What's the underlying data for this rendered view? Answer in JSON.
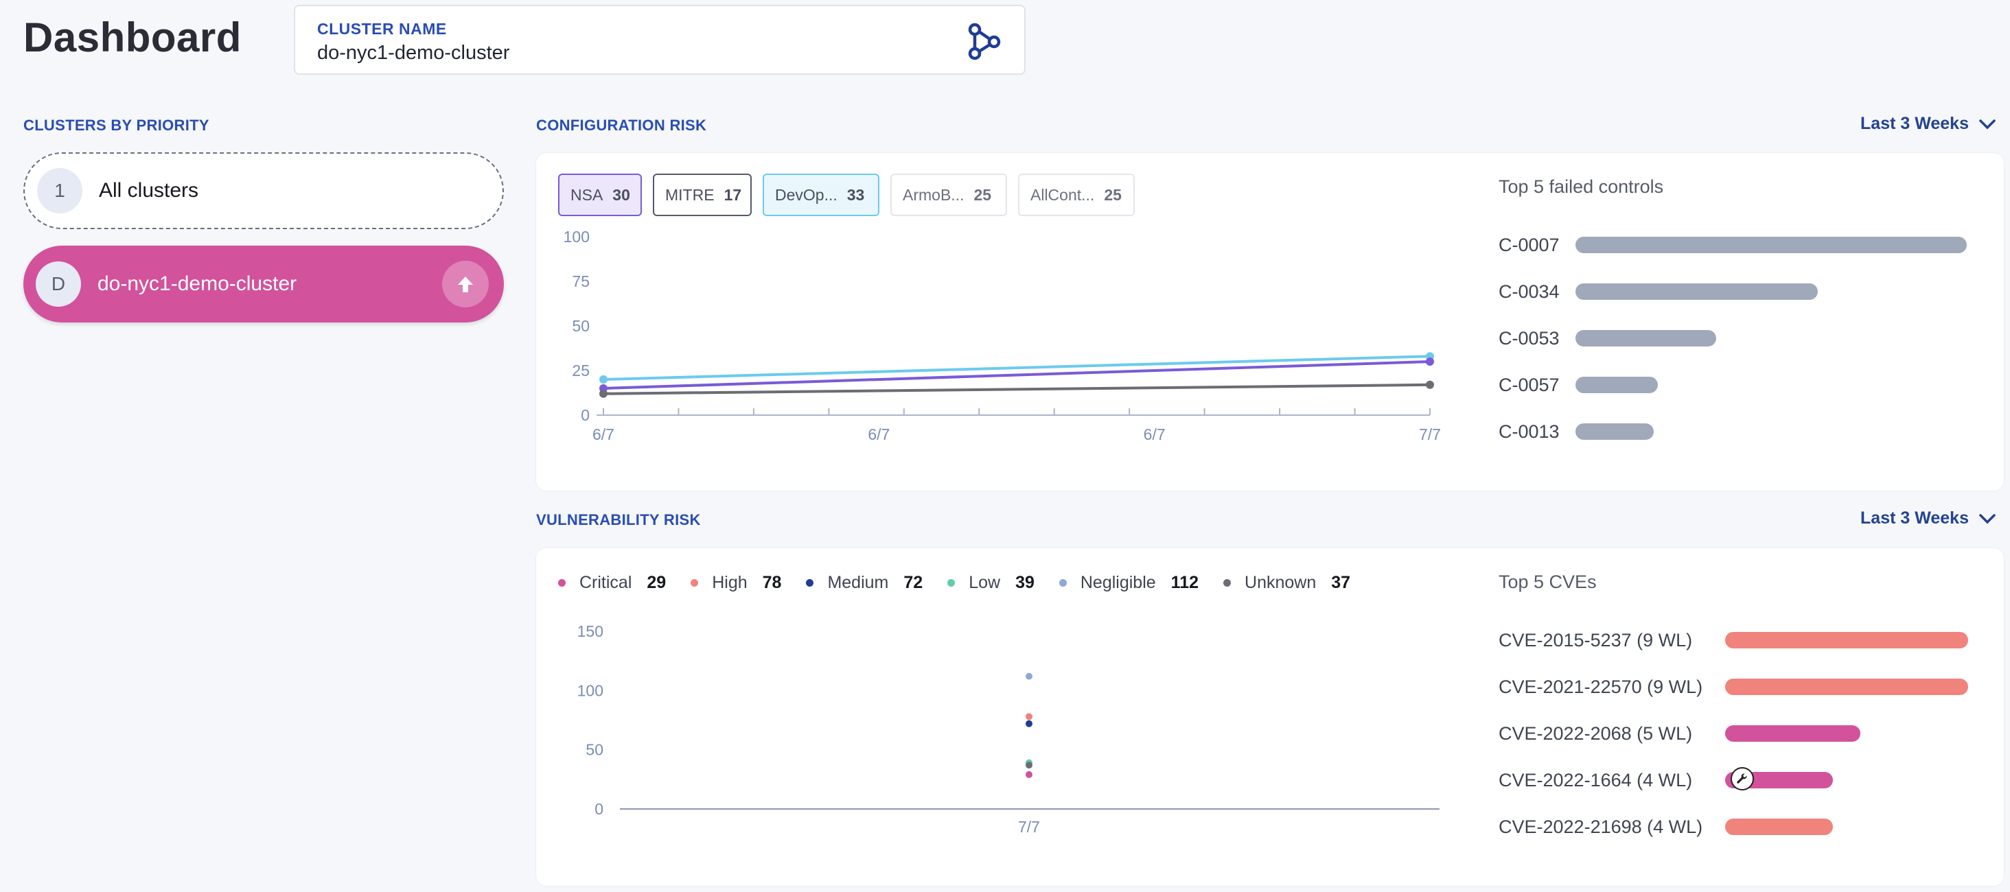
{
  "header": {
    "title": "Dashboard",
    "cluster_name_label": "CLUSTER NAME",
    "cluster_name_value": "do-nyc1-demo-cluster",
    "cluster_icon": "cluster-graph-icon"
  },
  "sidebar": {
    "title": "CLUSTERS BY PRIORITY",
    "items": [
      {
        "badge": "1",
        "label": "All clusters",
        "selected": false
      },
      {
        "badge": "D",
        "label": "do-nyc1-demo-cluster",
        "selected": true,
        "action_icon": "arrow-up-icon"
      }
    ]
  },
  "colors": {
    "accent": "#2a4db0",
    "cluster_active": "#d2529c",
    "nsa": "#7a5ad8",
    "mitre": "#6b6d74",
    "devops": "#6ccaee",
    "control_bar": "#a0a9b9",
    "critical": "#d2529c",
    "high": "#f0837c",
    "medium": "#1f3c96",
    "low": "#5fcfaa",
    "negligible": "#8fa8d8",
    "unknown": "#6b6d74"
  },
  "config_risk": {
    "title": "CONFIGURATION RISK",
    "range": "Last 3 Weeks",
    "frameworks": [
      {
        "name": "NSA",
        "value": "30"
      },
      {
        "name": "MITRE",
        "value": "17"
      },
      {
        "name": "DevOp...",
        "value": "33"
      },
      {
        "name": "ArmoB...",
        "value": "25"
      },
      {
        "name": "AllCont...",
        "value": "25"
      }
    ],
    "top_controls_title": "Top 5 failed controls",
    "top_controls": [
      {
        "id": "C-0007",
        "value": 100
      },
      {
        "id": "C-0034",
        "value": 62
      },
      {
        "id": "C-0053",
        "value": 36
      },
      {
        "id": "C-0057",
        "value": 21
      },
      {
        "id": "C-0013",
        "value": 20
      }
    ]
  },
  "vuln_risk": {
    "title": "VULNERABILITY RISK",
    "range": "Last 3 Weeks",
    "legend": [
      {
        "name": "Critical",
        "count": "29",
        "color_key": "critical"
      },
      {
        "name": "High",
        "count": "78",
        "color_key": "high"
      },
      {
        "name": "Medium",
        "count": "72",
        "color_key": "medium"
      },
      {
        "name": "Low",
        "count": "39",
        "color_key": "low"
      },
      {
        "name": "Negligible",
        "count": "112",
        "color_key": "negligible"
      },
      {
        "name": "Unknown",
        "count": "37",
        "color_key": "unknown"
      }
    ],
    "top_cves_title": "Top 5 CVEs",
    "top_cves": [
      {
        "id": "CVE-2015-5237 (9 WL)",
        "value": 9,
        "color_key": "high"
      },
      {
        "id": "CVE-2021-22570 (9 WL)",
        "value": 9,
        "color_key": "high"
      },
      {
        "id": "CVE-2022-2068 (5 WL)",
        "value": 5,
        "color_key": "critical"
      },
      {
        "id": "CVE-2022-1664 (4 WL)",
        "value": 4,
        "color_key": "critical",
        "icon": "wrench-icon"
      },
      {
        "id": "CVE-2022-21698 (4 WL)",
        "value": 4,
        "color_key": "high"
      }
    ]
  },
  "chart_data": [
    {
      "type": "line",
      "x": [
        "6/7",
        "7/7"
      ],
      "x_tick_labels": [
        "6/7",
        "6/7",
        "6/7",
        "7/7"
      ],
      "ylim": [
        0,
        100
      ],
      "y_ticks": [
        0,
        25,
        50,
        75,
        100
      ],
      "series": [
        {
          "color_key": "devops",
          "values": [
            20,
            33
          ]
        },
        {
          "color_key": "nsa",
          "values": [
            15,
            30
          ]
        },
        {
          "color_key": "mitre",
          "values": [
            12,
            17
          ]
        }
      ]
    },
    {
      "type": "scatter",
      "x": [
        "7/7"
      ],
      "ylim": [
        0,
        150
      ],
      "y_ticks": [
        0,
        50,
        100,
        150
      ],
      "series": [
        {
          "name": "Critical",
          "color_key": "critical",
          "values": [
            29
          ]
        },
        {
          "name": "High",
          "color_key": "high",
          "values": [
            78
          ]
        },
        {
          "name": "Medium",
          "color_key": "medium",
          "values": [
            72
          ]
        },
        {
          "name": "Low",
          "color_key": "low",
          "values": [
            39
          ]
        },
        {
          "name": "Negligible",
          "color_key": "negligible",
          "values": [
            112
          ]
        },
        {
          "name": "Unknown",
          "color_key": "unknown",
          "values": [
            37
          ]
        }
      ]
    }
  ]
}
